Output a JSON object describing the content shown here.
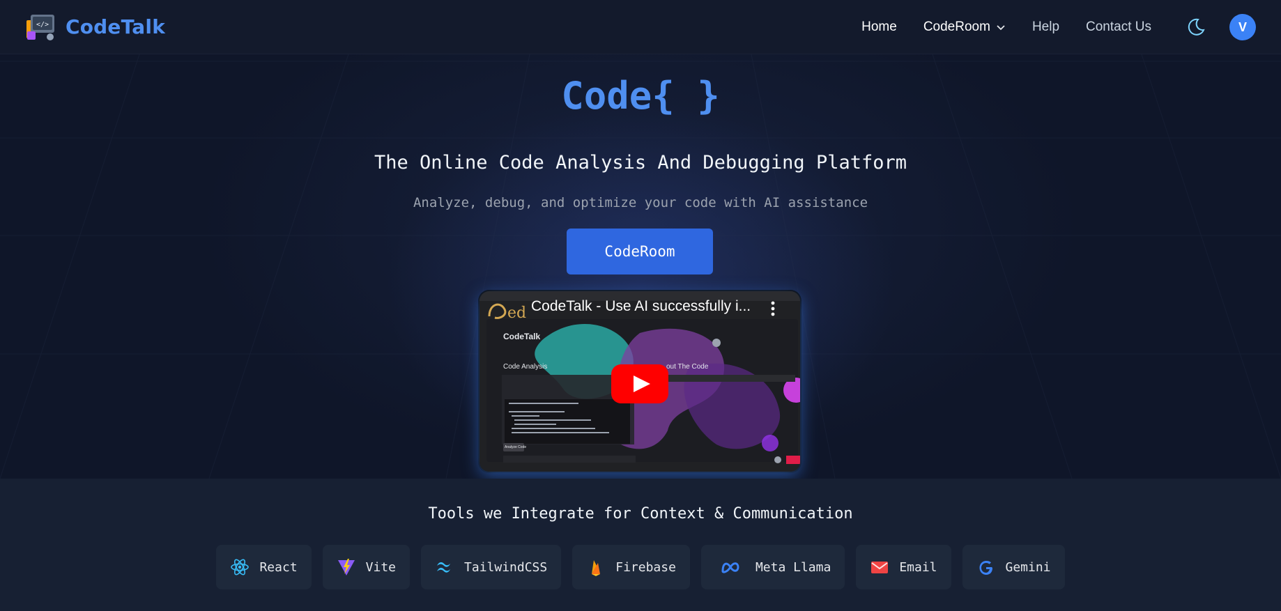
{
  "header": {
    "brand": "CodeTalk",
    "nav": [
      {
        "label": "Home",
        "active": true
      },
      {
        "label": "CodeRoom",
        "dropdown": true
      },
      {
        "label": "Help"
      },
      {
        "label": "Contact Us"
      }
    ],
    "theme_toggle_icon": "moon-icon",
    "avatar_initial": "V"
  },
  "hero": {
    "title": "Code{ }",
    "subtitle": "The Online Code Analysis And Debugging Platform",
    "description": "Analyze, debug, and optimize your code with AI assistance",
    "cta_label": "CodeRoom",
    "video": {
      "title": "CodeTalk - Use AI successfully i...",
      "inner_app_name": "CodeTalk",
      "inner_panel_left": "Code Analysis",
      "inner_panel_right": "out The Code",
      "inner_button": "Analyze Code"
    }
  },
  "tools": {
    "title": "Tools we Integrate for Context & Communication",
    "items": [
      {
        "label": "React",
        "icon": "react-icon"
      },
      {
        "label": "Vite",
        "icon": "vite-icon"
      },
      {
        "label": "TailwindCSS",
        "icon": "tailwind-icon"
      },
      {
        "label": "Firebase",
        "icon": "firebase-icon"
      },
      {
        "label": "Meta Llama",
        "icon": "meta-icon"
      },
      {
        "label": "Email",
        "icon": "email-icon"
      },
      {
        "label": "Gemini",
        "icon": "google-icon"
      }
    ]
  },
  "colors": {
    "accent": "#4f8ff0",
    "button": "#2f67e0",
    "background": "#111827"
  }
}
